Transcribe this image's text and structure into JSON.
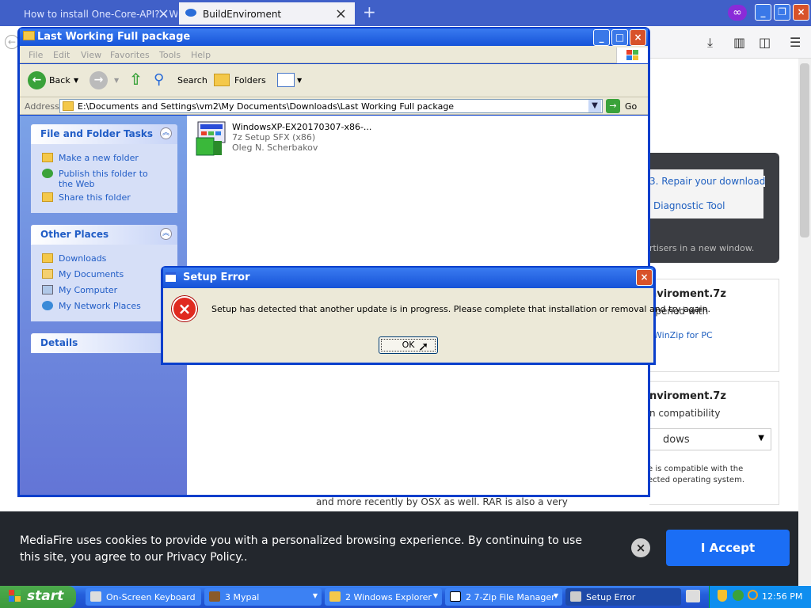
{
  "browser": {
    "tabs": [
      {
        "title": "How to install One-Core-API? - W"
      },
      {
        "title": "BuildEnviroment"
      }
    ],
    "new_tab": "+",
    "window_buttons": [
      "_",
      "❐",
      "×"
    ]
  },
  "background_page": {
    "repair_link": "3. Repair your download",
    "diagnostic_link": "Diagnostic Tool",
    "ads_note": "rtisers in a new window.",
    "card1_title": "nviroment.7z",
    "card1_text": "opened with",
    "card1_link": "WinZip for PC",
    "card2_title": "nviroment.7z",
    "card2_text": "n compatibility",
    "dropdown_value": "dows",
    "compat_text_1": "e is compatible with the",
    "compat_text_2": "ected operating system.",
    "behind_text": "and more recently by OSX as well. RAR is also a very",
    "cookie_text": "MediaFire uses cookies to provide you with a personalized browsing experience. By continuing to use this site, you agree to our Privacy Policy..",
    "cookie_close": "×",
    "accept_label": "I Accept"
  },
  "explorer": {
    "title": "Last Working Full package",
    "menu": [
      "File",
      "Edit",
      "View",
      "Favorites",
      "Tools",
      "Help"
    ],
    "toolbar": {
      "back": "Back",
      "search": "Search",
      "folders": "Folders"
    },
    "address_label": "Address",
    "address_value": "E:\\Documents and Settings\\vm2\\My Documents\\Downloads\\Last Working Full package",
    "go_label": "Go",
    "tasks_title": "File and Folder Tasks",
    "tasks": [
      "Make a new folder",
      "Publish this folder to the Web",
      "Share this folder"
    ],
    "places_title": "Other Places",
    "places": [
      "Downloads",
      "My Documents",
      "My Computer",
      "My Network Places"
    ],
    "details_title": "Details",
    "file": {
      "name": "WindowsXP-EX20170307-x86-...",
      "type": "7z Setup SFX (x86)",
      "company": "Oleg N. Scherbakov"
    }
  },
  "dialog": {
    "title": "Setup Error",
    "message": "Setup has detected that another update is in progress.  Please complete that installation or removal and try again.",
    "ok_label": "OK",
    "error_icon": "×"
  },
  "taskbar": {
    "start_label": "start",
    "items": [
      {
        "label": "On-Screen Keyboard"
      },
      {
        "label": "3 Mypal"
      },
      {
        "label": "2 Windows Explorer"
      },
      {
        "label": "2 7-Zip File Manager"
      },
      {
        "label": "Setup Error"
      }
    ],
    "clock": "12:56 PM"
  },
  "colors": {
    "xp_blue": "#0a3fcc",
    "xp_title": "#1653d8",
    "task_pane": "#6375d6",
    "accept": "#1b6ef5",
    "error_red": "#e02a20"
  }
}
